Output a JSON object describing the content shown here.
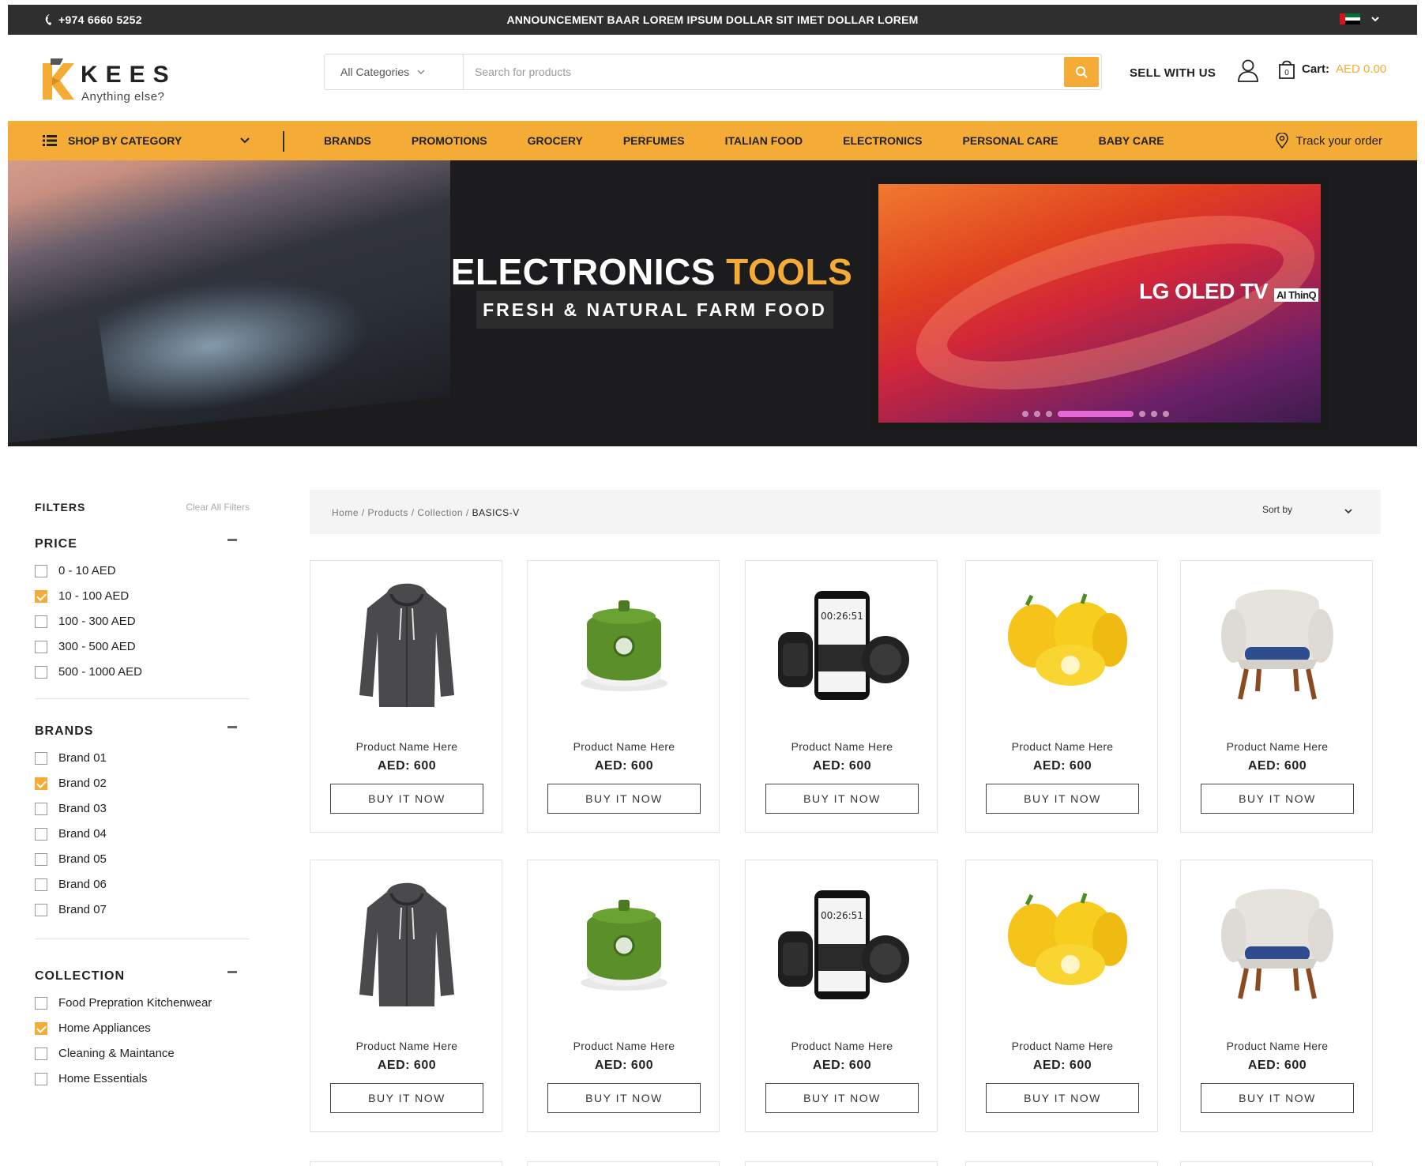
{
  "topbar": {
    "phone": "+974 6660 5252",
    "announcement": "ANNOUNCEMENT BAAR LOREM IPSUM DOLLAR SIT IMET DOLLAR LOREM",
    "flag_icon": "uae-flag-icon"
  },
  "header": {
    "logo_word": "KEES",
    "logo_tagline": "Anything else?",
    "search": {
      "category": "All Categories",
      "placeholder": "Search for products"
    },
    "sell_label": "SELL WITH US",
    "cart_label": "Cart:",
    "cart_amount": "AED 0.00",
    "cart_count": "0"
  },
  "nav": {
    "shop_by_category": "SHOP BY CATEGORY",
    "links": [
      "BRANDS",
      "PROMOTIONS",
      "GROCERY",
      "PERFUMES",
      "ITALIAN FOOD",
      "ELECTRONICS",
      "PERSONAL CARE",
      "BABY CARE"
    ],
    "track_label": "Track your order"
  },
  "hero": {
    "headline_white": "ELECTRONICS",
    "headline_accent": "TOOLS",
    "subheadline": "FRESH & NATURAL FARM FOOD",
    "tv_brand": "LG OLED TV",
    "tv_badge": "AI ThinQ"
  },
  "filters": {
    "title": "FILTERS",
    "clear_all": "Clear All Filters",
    "price": {
      "title": "PRICE",
      "options": [
        {
          "label": "0 - 10 AED",
          "checked": false
        },
        {
          "label": "10 - 100 AED",
          "checked": true
        },
        {
          "label": "100 - 300 AED",
          "checked": false
        },
        {
          "label": "300 - 500 AED",
          "checked": false
        },
        {
          "label": "500 - 1000 AED",
          "checked": false
        }
      ]
    },
    "brands": {
      "title": "BRANDS",
      "options": [
        {
          "label": "Brand 01",
          "checked": false
        },
        {
          "label": "Brand 02",
          "checked": true
        },
        {
          "label": "Brand 03",
          "checked": false
        },
        {
          "label": "Brand 04",
          "checked": false
        },
        {
          "label": "Brand 05",
          "checked": false
        },
        {
          "label": "Brand 06",
          "checked": false
        },
        {
          "label": "Brand 07",
          "checked": false
        }
      ]
    },
    "collection": {
      "title": "COLLECTION",
      "options": [
        {
          "label": "Food Prepration Kitchenwear",
          "checked": false
        },
        {
          "label": "Home Appliances",
          "checked": true
        },
        {
          "label": "Cleaning & Maintance",
          "checked": false
        },
        {
          "label": "Home Essentials",
          "checked": false
        }
      ]
    }
  },
  "breadcrumb": {
    "items": [
      "Home",
      "Products",
      "Collection"
    ],
    "current": "BASICS-V",
    "sort_label": "Sort by"
  },
  "products": [
    {
      "name": "Product Name Here",
      "price": "AED: 600",
      "button": "BUY IT NOW",
      "image": "hoodie"
    },
    {
      "name": "Product Name Here",
      "price": "AED: 600",
      "button": "BUY IT NOW",
      "image": "rice-cooker"
    },
    {
      "name": "Product Name Here",
      "price": "AED: 600",
      "button": "BUY IT NOW",
      "image": "smartwatch"
    },
    {
      "name": "Product Name Here",
      "price": "AED: 600",
      "button": "BUY IT NOW",
      "image": "peppers"
    },
    {
      "name": "Product Name Here",
      "price": "AED: 600",
      "button": "BUY IT NOW",
      "image": "armchair"
    },
    {
      "name": "Product Name Here",
      "price": "AED: 600",
      "button": "BUY IT NOW",
      "image": "hoodie"
    },
    {
      "name": "Product Name Here",
      "price": "AED: 600",
      "button": "BUY IT NOW",
      "image": "rice-cooker"
    },
    {
      "name": "Product Name Here",
      "price": "AED: 600",
      "button": "BUY IT NOW",
      "image": "smartwatch"
    },
    {
      "name": "Product Name Here",
      "price": "AED: 600",
      "button": "BUY IT NOW",
      "image": "peppers"
    },
    {
      "name": "Product Name Here",
      "price": "AED: 600",
      "button": "BUY IT NOW",
      "image": "armchair"
    }
  ],
  "colors": {
    "accent": "#f5ac36",
    "topbar": "#2f2f2f",
    "text": "#222222"
  }
}
